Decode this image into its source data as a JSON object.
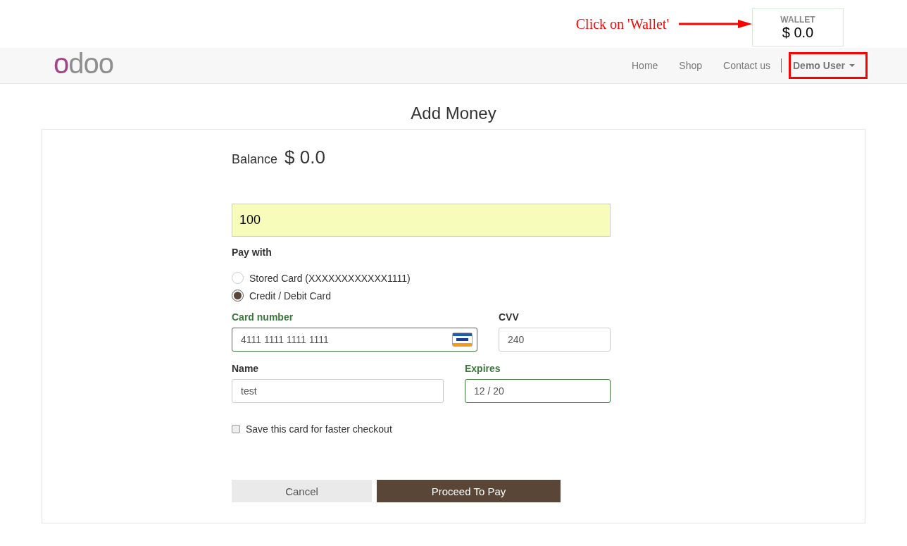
{
  "annotation": {
    "text": "Click on 'Wallet'"
  },
  "wallet": {
    "label": "WALLET",
    "amount": "$ 0.0"
  },
  "navbar": {
    "logo": "odoo",
    "links": [
      "Home",
      "Shop",
      "Contact us"
    ],
    "user_menu": {
      "label": "Demo User",
      "highlighted": true
    }
  },
  "page": {
    "title": "Add Money",
    "balance_label": "Balance",
    "balance_value": "$ 0.0",
    "amount": "100",
    "pay_with": {
      "label": "Pay with",
      "options": [
        {
          "label": "Stored Card (XXXXXXXXXXXX1111)",
          "selected": false
        },
        {
          "label": "Credit / Debit Card",
          "selected": true
        }
      ]
    },
    "fields": {
      "card_number": {
        "label": "Card number",
        "value": "4111 1111 1111 1111",
        "valid": true
      },
      "cvv": {
        "label": "CVV",
        "value": "240",
        "valid": false
      },
      "name": {
        "label": "Name",
        "value": "test",
        "valid": false
      },
      "expires": {
        "label": "Expires",
        "value": "12 / 20",
        "valid": true
      }
    },
    "save_card": {
      "label": "Save this card for faster checkout",
      "checked": false
    },
    "buttons": {
      "cancel": "Cancel",
      "proceed": "Proceed To Pay"
    }
  }
}
